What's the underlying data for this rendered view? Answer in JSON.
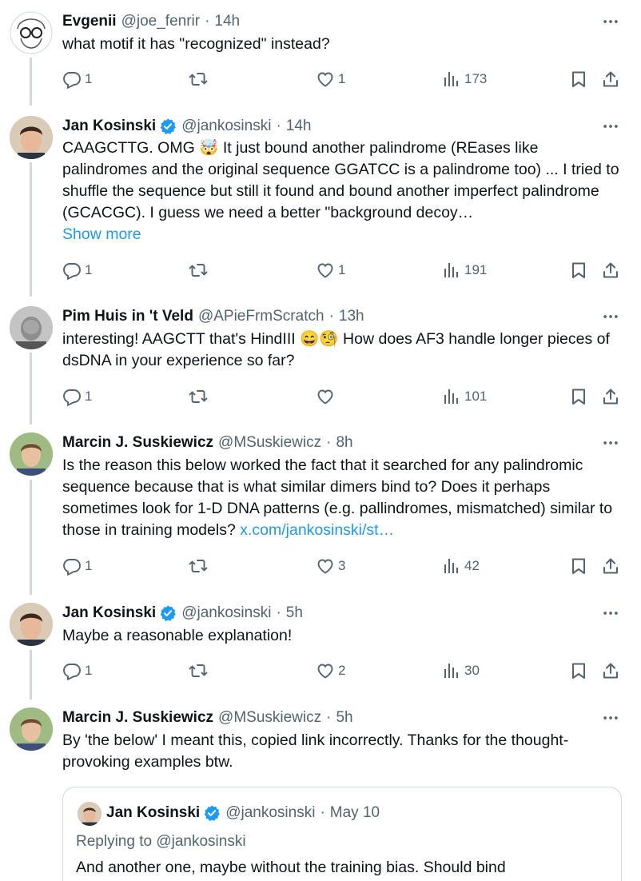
{
  "colors": {
    "accent": "#1d9bf0",
    "muted": "#536471",
    "text": "#0f1419",
    "border": "#cfd9de"
  },
  "tweets": [
    {
      "name": "Evgenii",
      "verified": false,
      "handle": "@joe_fenrir",
      "time": "14h",
      "text": "what motif it has \"recognized\" instead?",
      "replies": "1",
      "reposts": "",
      "likes": "1",
      "views": "173"
    },
    {
      "name": "Jan Kosinski",
      "verified": true,
      "handle": "@jankosinski",
      "time": "14h",
      "text": "CAAGCTTG. OMG 🤯 It just bound another palindrome (REases like palindromes and the original sequence GGATCC is a palindrome too) ... I tried to shuffle the sequence but still it found and bound another imperfect palindrome (GCACGC). I guess we need a better \"background decoy…",
      "show_more": "Show more",
      "replies": "1",
      "reposts": "",
      "likes": "1",
      "views": "191"
    },
    {
      "name": "Pim Huis in 't Veld",
      "verified": false,
      "handle": "@APieFrmScratch",
      "time": "13h",
      "text": "interesting! AAGCTT that's HindIII 😄🧐 How does AF3 handle longer pieces of dsDNA in your experience so far?",
      "replies": "1",
      "reposts": "",
      "likes": "",
      "views": "101"
    },
    {
      "name": "Marcin J. Suskiewicz",
      "verified": false,
      "handle": "@MSuskiewicz",
      "time": "8h",
      "text": "Is the reason this below worked the fact that it searched for any palindromic sequence because that is what similar dimers bind to? Does it perhaps sometimes look for 1-D DNA patterns (e.g. pallindromes, mismatched) similar to those in training models? ",
      "link": "x.com/jankosinski/st…",
      "replies": "1",
      "reposts": "",
      "likes": "3",
      "views": "42"
    },
    {
      "name": "Jan Kosinski",
      "verified": true,
      "handle": "@jankosinski",
      "time": "5h",
      "text": "Maybe a reasonable explanation!",
      "replies": "1",
      "reposts": "",
      "likes": "2",
      "views": "30"
    },
    {
      "name": "Marcin J. Suskiewicz",
      "verified": false,
      "handle": "@MSuskiewicz",
      "time": "5h",
      "text": "By 'the below' I meant this, copied link incorrectly. Thanks for the thought-provoking examples btw."
    }
  ],
  "quote": {
    "name": "Jan Kosinski",
    "verified": true,
    "handle": "@jankosinski",
    "time": "May 10",
    "replying": "Replying to @jankosinski",
    "text": "And another one, maybe without the training bias. Should bind"
  },
  "sep": "·",
  "icons": {
    "more": "more-dots-icon",
    "reply": "reply-icon",
    "repost": "repost-icon",
    "like": "heart-icon",
    "views": "views-icon",
    "bookmark": "bookmark-icon",
    "share": "share-icon",
    "verified": "verified-badge-icon"
  }
}
